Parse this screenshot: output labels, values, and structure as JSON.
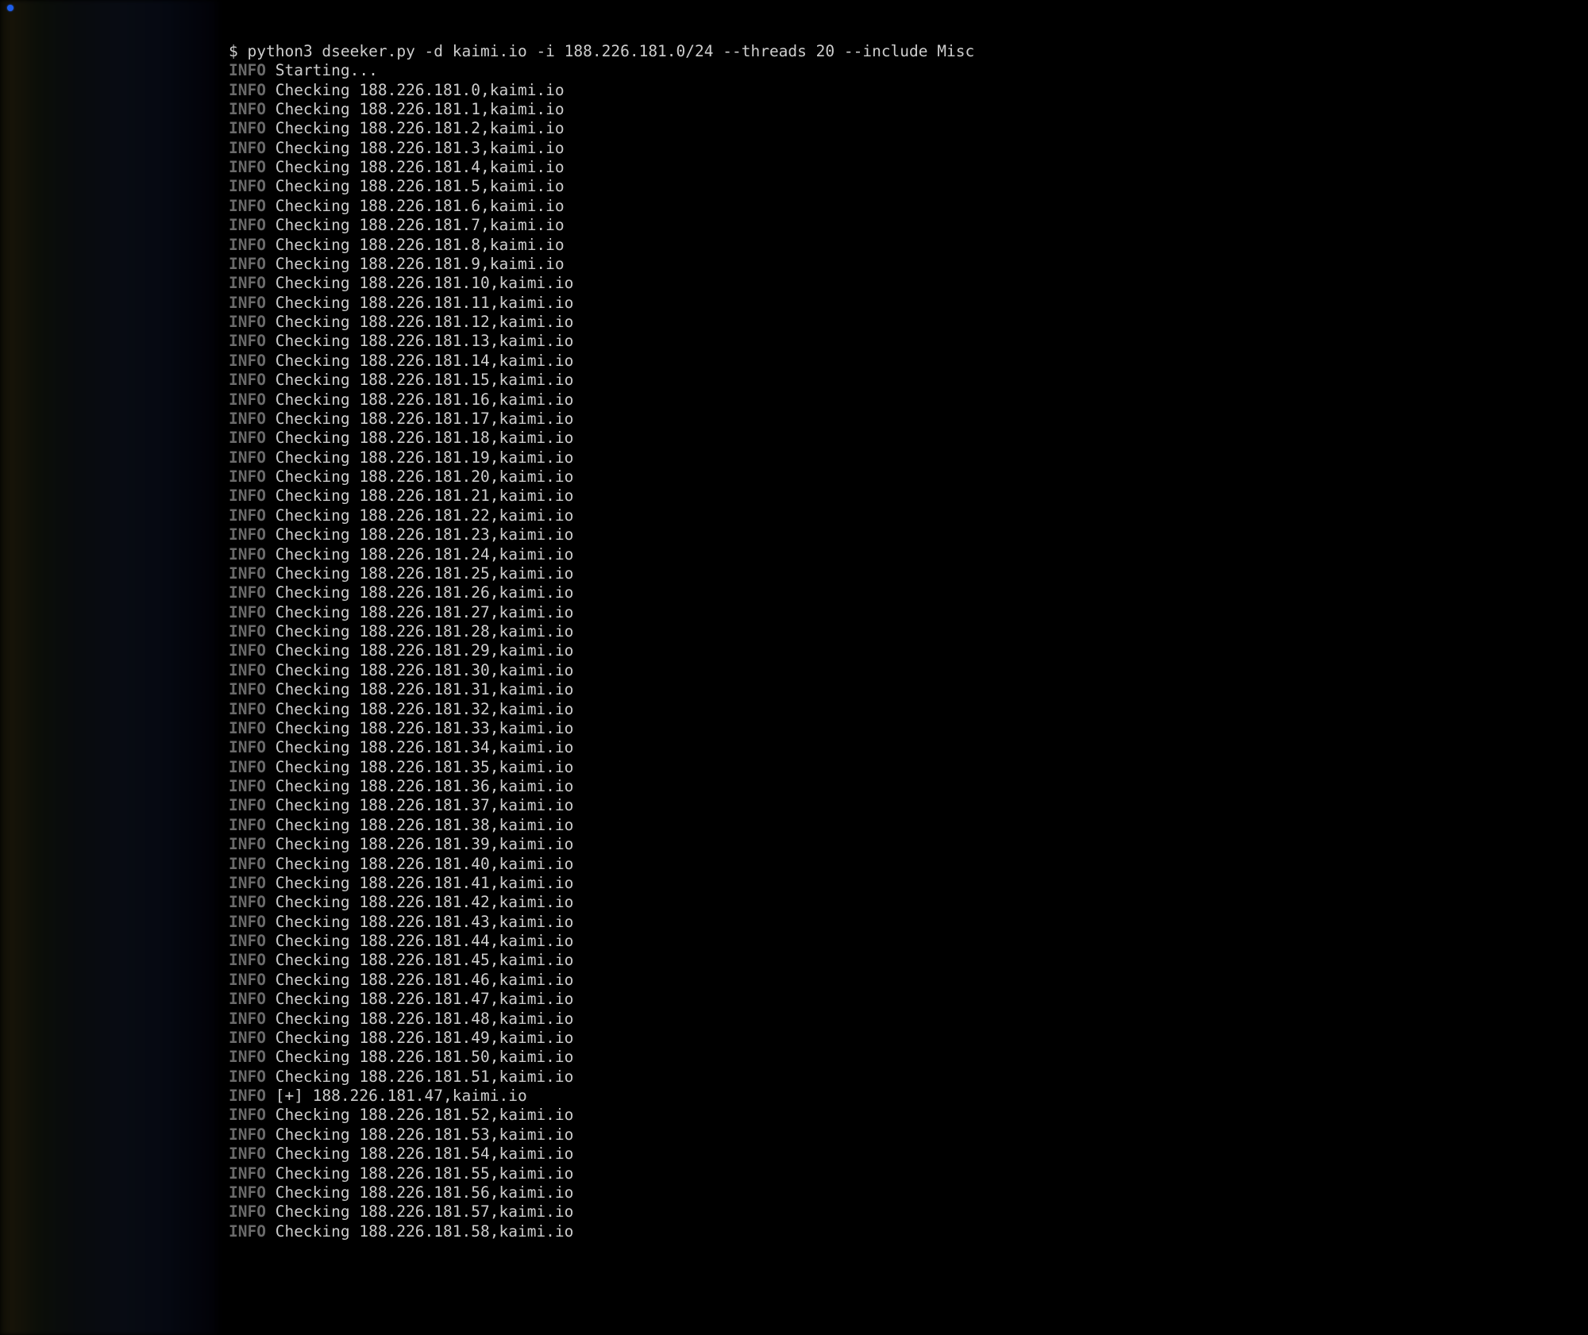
{
  "prompt": {
    "symbol": "$",
    "command": "python3 dseeker.py -d kaimi.io -i 188.226.181.0/24 --threads 20 --include Misc"
  },
  "info_label": "INFO",
  "domain": "kaimi.io",
  "ip_base": "188.226.181",
  "starting_msg": "Starting...",
  "checking_word": "Checking",
  "found_prefix": "[+]",
  "found_ip": "188.226.181.47",
  "lines": [
    {
      "type": "start"
    },
    {
      "type": "check",
      "n": 0
    },
    {
      "type": "check",
      "n": 1
    },
    {
      "type": "check",
      "n": 2
    },
    {
      "type": "check",
      "n": 3
    },
    {
      "type": "check",
      "n": 4
    },
    {
      "type": "check",
      "n": 5
    },
    {
      "type": "check",
      "n": 6
    },
    {
      "type": "check",
      "n": 7
    },
    {
      "type": "check",
      "n": 8
    },
    {
      "type": "check",
      "n": 9
    },
    {
      "type": "check",
      "n": 10
    },
    {
      "type": "check",
      "n": 11
    },
    {
      "type": "check",
      "n": 12
    },
    {
      "type": "check",
      "n": 13
    },
    {
      "type": "check",
      "n": 14
    },
    {
      "type": "check",
      "n": 15
    },
    {
      "type": "check",
      "n": 16
    },
    {
      "type": "check",
      "n": 17
    },
    {
      "type": "check",
      "n": 18
    },
    {
      "type": "check",
      "n": 19
    },
    {
      "type": "check",
      "n": 20
    },
    {
      "type": "check",
      "n": 21
    },
    {
      "type": "check",
      "n": 22
    },
    {
      "type": "check",
      "n": 23
    },
    {
      "type": "check",
      "n": 24
    },
    {
      "type": "check",
      "n": 25
    },
    {
      "type": "check",
      "n": 26
    },
    {
      "type": "check",
      "n": 27
    },
    {
      "type": "check",
      "n": 28
    },
    {
      "type": "check",
      "n": 29
    },
    {
      "type": "check",
      "n": 30
    },
    {
      "type": "check",
      "n": 31
    },
    {
      "type": "check",
      "n": 32
    },
    {
      "type": "check",
      "n": 33
    },
    {
      "type": "check",
      "n": 34
    },
    {
      "type": "check",
      "n": 35
    },
    {
      "type": "check",
      "n": 36
    },
    {
      "type": "check",
      "n": 37
    },
    {
      "type": "check",
      "n": 38
    },
    {
      "type": "check",
      "n": 39
    },
    {
      "type": "check",
      "n": 40
    },
    {
      "type": "check",
      "n": 41
    },
    {
      "type": "check",
      "n": 42
    },
    {
      "type": "check",
      "n": 43
    },
    {
      "type": "check",
      "n": 44
    },
    {
      "type": "check",
      "n": 45
    },
    {
      "type": "check",
      "n": 46
    },
    {
      "type": "check",
      "n": 47
    },
    {
      "type": "check",
      "n": 48
    },
    {
      "type": "check",
      "n": 49
    },
    {
      "type": "check",
      "n": 50
    },
    {
      "type": "check",
      "n": 51
    },
    {
      "type": "found"
    },
    {
      "type": "check",
      "n": 52
    },
    {
      "type": "check",
      "n": 53
    },
    {
      "type": "check",
      "n": 54
    },
    {
      "type": "check",
      "n": 55
    },
    {
      "type": "check",
      "n": 56
    },
    {
      "type": "check",
      "n": 57
    },
    {
      "type": "check",
      "n": 58
    }
  ]
}
